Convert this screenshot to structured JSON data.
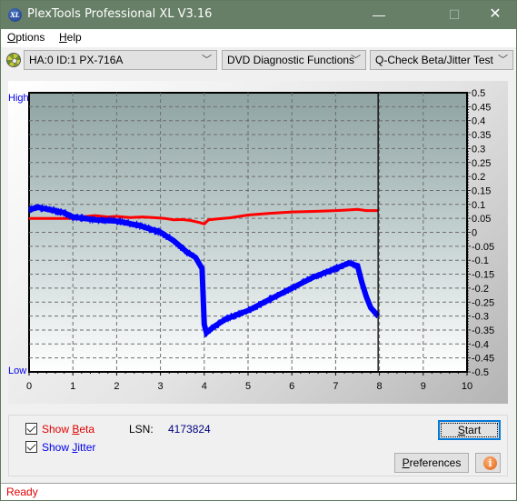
{
  "window": {
    "title": "PlexTools Professional XL V3.16",
    "app_icon_label": "XL",
    "minimize_glyph": "—",
    "maximize_glyph": "☐",
    "close_glyph": "✕"
  },
  "menu": {
    "items": [
      {
        "label": "Options",
        "mnemonic": "O",
        "rest": "ptions"
      },
      {
        "label": "Help",
        "mnemonic": "H",
        "rest": "elp"
      }
    ]
  },
  "toolbar": {
    "drive_select": "HA:0 ID:1  PX-716A",
    "function_select": "DVD Diagnostic Functions",
    "test_select": "Q-Check Beta/Jitter Test",
    "chevron_glyph": "﹀"
  },
  "chart_data": {
    "type": "line",
    "title": "",
    "xlabel": "",
    "ylabel": "",
    "xlim": [
      0,
      10
    ],
    "ylim": [
      -0.5,
      0.5
    ],
    "x_ticks": [
      "0",
      "1",
      "2",
      "3",
      "4",
      "5",
      "6",
      "7",
      "8",
      "9",
      "10"
    ],
    "y_ticks": [
      "0.5",
      "0.45",
      "0.4",
      "0.35",
      "0.3",
      "0.25",
      "0.2",
      "0.15",
      "0.1",
      "0.05",
      "0",
      "-0.05",
      "-0.1",
      "-0.15",
      "-0.2",
      "-0.25",
      "-0.3",
      "-0.35",
      "-0.4",
      "-0.45",
      "-0.5"
    ],
    "y_left_top_label": "High",
    "y_left_bottom_label": "Low",
    "grid": true,
    "cursor_x": 7.97,
    "series": [
      {
        "name": "Beta",
        "color": "#ff0000",
        "x": [
          0.0,
          0.2,
          0.5,
          0.8,
          1.1,
          1.2,
          1.5,
          1.8,
          2.0,
          2.3,
          2.6,
          2.9,
          3.1,
          3.3,
          3.5,
          3.7,
          3.9,
          4.0,
          4.1,
          4.3,
          4.6,
          5.0,
          5.5,
          6.0,
          6.5,
          7.0,
          7.3,
          7.5,
          7.7,
          7.97
        ],
        "y": [
          0.05,
          0.05,
          0.05,
          0.05,
          0.05,
          0.055,
          0.06,
          0.055,
          0.057,
          0.053,
          0.055,
          0.052,
          0.05,
          0.045,
          0.046,
          0.042,
          0.035,
          0.03,
          0.045,
          0.048,
          0.052,
          0.062,
          0.068,
          0.073,
          0.075,
          0.078,
          0.08,
          0.082,
          0.078,
          0.078
        ]
      },
      {
        "name": "Jitter",
        "color": "#0000ff",
        "x": [
          0.0,
          0.2,
          0.5,
          0.8,
          1.0,
          1.5,
          2.0,
          2.5,
          3.0,
          3.3,
          3.6,
          3.8,
          3.95,
          4.0,
          4.05,
          4.2,
          4.5,
          5.0,
          5.5,
          6.0,
          6.5,
          7.0,
          7.3,
          7.5,
          7.6,
          7.7,
          7.8,
          7.97
        ],
        "y": [
          0.08,
          0.09,
          0.08,
          0.07,
          0.055,
          0.045,
          0.04,
          0.025,
          0.0,
          -0.03,
          -0.07,
          -0.09,
          -0.13,
          -0.33,
          -0.36,
          -0.34,
          -0.31,
          -0.28,
          -0.24,
          -0.2,
          -0.16,
          -0.13,
          -0.11,
          -0.12,
          -0.18,
          -0.23,
          -0.27,
          -0.3
        ]
      }
    ]
  },
  "controls": {
    "show_beta": {
      "checked": true,
      "prefix": "Show ",
      "mnemonic": "B",
      "rest": "eta"
    },
    "show_jitter": {
      "checked": true,
      "prefix": "Show ",
      "mnemonic": "J",
      "rest": "itter"
    },
    "lsn_label": "LSN:",
    "lsn_value": "4173824",
    "start_button": {
      "mnemonic": "S",
      "rest": "tart"
    },
    "preferences_button": {
      "mnemonic": "P",
      "rest": "references"
    },
    "info_glyph": "i"
  },
  "status": {
    "text": "Ready"
  }
}
